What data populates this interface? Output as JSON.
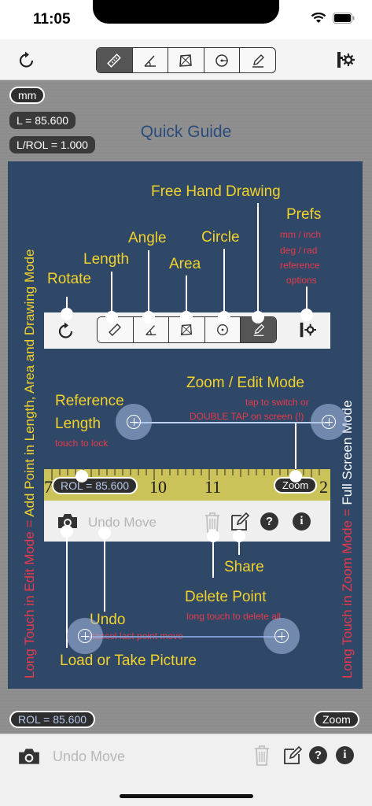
{
  "status": {
    "time": "11:05"
  },
  "toolbar": {
    "icons": [
      "rotate-icon",
      "ruler-length-icon",
      "angle-icon",
      "area-icon",
      "circle-icon",
      "pencil-icon",
      "prefs-icon"
    ]
  },
  "canvas": {
    "unit_button": "mm",
    "length_readout": "L = 85.600",
    "ratio_readout": "L/ROL = 1.000",
    "rol_button": "ROL = 85.600",
    "zoom_button": "Zoom"
  },
  "guide": {
    "title": "Quick Guide",
    "labels": {
      "free_hand": "Free Hand Drawing",
      "prefs": "Prefs",
      "prefs_sub1": "mm / inch",
      "prefs_sub2": "deg / rad",
      "prefs_sub3": "reference",
      "prefs_sub4": "options",
      "angle": "Angle",
      "circle": "Circle",
      "length": "Length",
      "area": "Area",
      "rotate": "Rotate",
      "zoom_edit": "Zoom / Edit Mode",
      "zoom_sub1": "tap to switch or",
      "zoom_sub2": "DOUBLE TAP on screen (!)",
      "reference1": "Reference",
      "reference2": "Length",
      "touch_lock": "touch to lock",
      "share": "Share",
      "delete_point": "Delete Point",
      "delete_sub": "long touch to delete all",
      "undo": "Undo",
      "undo_sub": "cancel last point move",
      "load_picture": "Load or Take Picture",
      "left_vertical_red": "Long Touch in Edit Mode = ",
      "left_vertical_yellow": "Add Point in Length, Area and Drawing Mode",
      "right_vertical_red": "Long Touch in Zoom Mode = ",
      "right_vertical_white": "Full Screen Mode"
    },
    "mini": {
      "rol": "ROL = 85.600",
      "zoom": "Zoom",
      "undo_move": "Undo Move",
      "ruler_numbers": [
        "7",
        "10",
        "11",
        "2"
      ]
    }
  },
  "bottom": {
    "undo_move": "Undo Move"
  },
  "colors": {
    "panel": "#2f4868",
    "yellow": "#f3d22a",
    "red": "#e8394a"
  }
}
